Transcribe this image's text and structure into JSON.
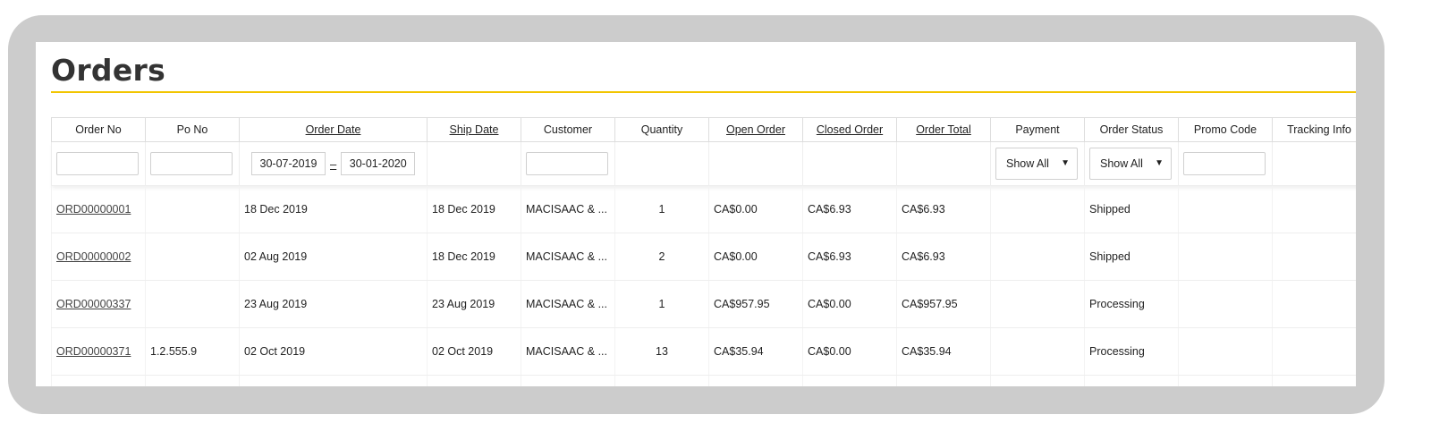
{
  "page": {
    "title": "Orders",
    "accent_color": "#f2c500"
  },
  "columns": [
    {
      "label": "Order No",
      "sortable": false
    },
    {
      "label": "Po No",
      "sortable": false
    },
    {
      "label": "Order Date",
      "sortable": true
    },
    {
      "label": "Ship Date",
      "sortable": true
    },
    {
      "label": "Customer",
      "sortable": false
    },
    {
      "label": "Quantity",
      "sortable": false
    },
    {
      "label": "Open Order",
      "sortable": true
    },
    {
      "label": "Closed Order",
      "sortable": true
    },
    {
      "label": "Order Total",
      "sortable": true
    },
    {
      "label": "Payment",
      "sortable": false
    },
    {
      "label": "Order Status",
      "sortable": false
    },
    {
      "label": "Promo Code",
      "sortable": false
    },
    {
      "label": "Tracking Info",
      "sortable": false
    }
  ],
  "filters": {
    "order_no": "",
    "po_no": "",
    "order_date_from": "30-07-2019",
    "order_date_separator": "–",
    "order_date_to": "30-01-2020",
    "customer": "",
    "payment": "Show All",
    "order_status": "Show All",
    "promo_code": ""
  },
  "rows": [
    {
      "order_no": "ORD00000001",
      "po_no": "",
      "order_date": "18 Dec 2019",
      "ship_date": "18 Dec 2019",
      "customer": "MACISAAC & ...",
      "quantity": "1",
      "open_order": "CA$0.00",
      "closed_order": "CA$6.93",
      "order_total": "CA$6.93",
      "payment": "",
      "order_status": "Shipped",
      "promo_code": "",
      "tracking_info": ""
    },
    {
      "order_no": "ORD00000002",
      "po_no": "",
      "order_date": "02 Aug 2019",
      "ship_date": "18 Dec 2019",
      "customer": "MACISAAC & ...",
      "quantity": "2",
      "open_order": "CA$0.00",
      "closed_order": "CA$6.93",
      "order_total": "CA$6.93",
      "payment": "",
      "order_status": "Shipped",
      "promo_code": "",
      "tracking_info": ""
    },
    {
      "order_no": "ORD00000337",
      "po_no": "",
      "order_date": "23 Aug 2019",
      "ship_date": "23 Aug 2019",
      "customer": "MACISAAC & ...",
      "quantity": "1",
      "open_order": "CA$957.95",
      "closed_order": "CA$0.00",
      "order_total": "CA$957.95",
      "payment": "",
      "order_status": "Processing",
      "promo_code": "",
      "tracking_info": ""
    },
    {
      "order_no": "ORD00000371",
      "po_no": "1.2.555.9",
      "order_date": "02 Oct 2019",
      "ship_date": "02 Oct 2019",
      "customer": "MACISAAC & ...",
      "quantity": "13",
      "open_order": "CA$35.94",
      "closed_order": "CA$0.00",
      "order_total": "CA$35.94",
      "payment": "",
      "order_status": "Processing",
      "promo_code": "",
      "tracking_info": ""
    }
  ]
}
